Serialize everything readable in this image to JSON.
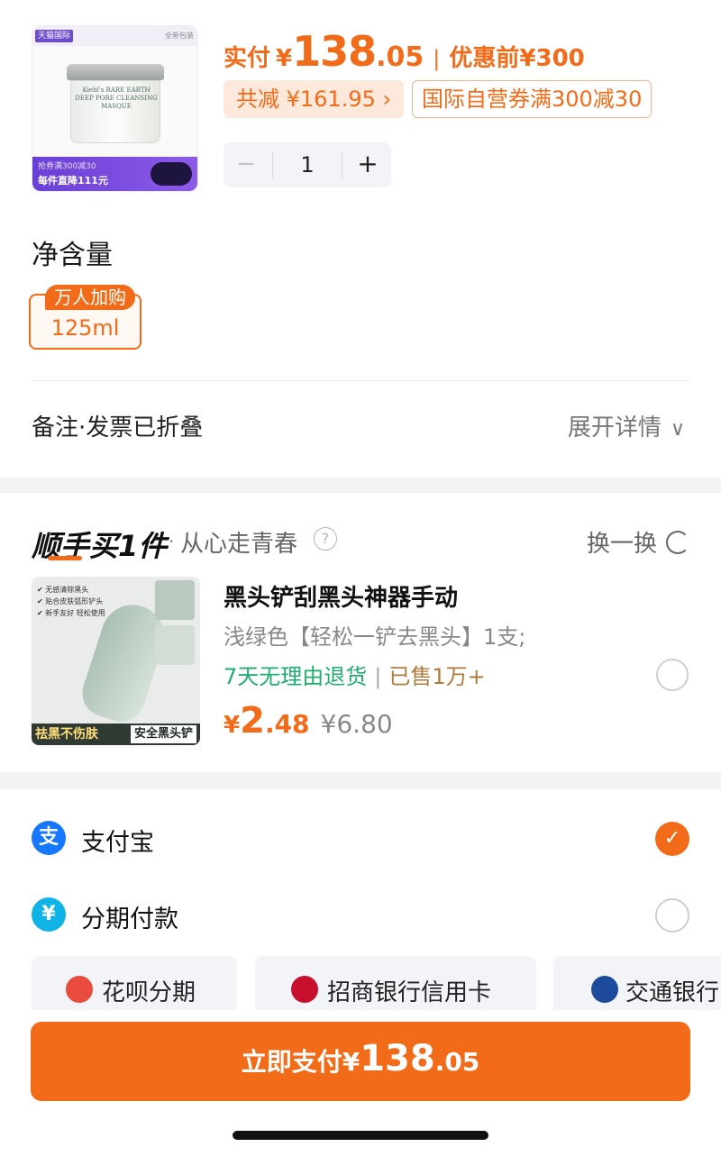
{
  "product": {
    "image_brand_tag": "天猫国际",
    "image_corner_text": "全新包装",
    "jar_label": "Kiehl's RARE EARTH DEEP PORE CLEANSING MASQUE",
    "image_promo_line1": "抢券满300减30",
    "image_promo_line2": "每件直降111元",
    "pay_label": "实付",
    "currency": "¥",
    "pay_integer": "138",
    "pay_decimal": ".05",
    "separator": "|",
    "before_discount_label": "优惠前",
    "before_discount_price": "¥300",
    "total_discount": "共减 ¥161.95 ›",
    "coupon": "国际自营券满300减30",
    "quantity": {
      "minus": "−",
      "value": "1",
      "plus": "+"
    }
  },
  "spec": {
    "title": "净含量",
    "option_tag": "万人加购",
    "option_value": "125ml"
  },
  "notes": {
    "label": "备注·发票已折叠",
    "expand": "展开详情",
    "chevron": "∨"
  },
  "recommend": {
    "title": "顺手买1件",
    "dot": "·",
    "subtitle": "从心走青春",
    "help": "?",
    "swap": "换一换",
    "image_features": "✔ 无感清除黑头\n✔ 贴合皮肤弧形铲头\n✔ 新手友好 轻松使用",
    "image_bar_left": "祛黑不伤肤",
    "image_bar_right": "安全黑头铲",
    "item_title": "黑头铲刮黑头神器手动",
    "item_spec": "浅绿色【轻松一铲去黑头】1支;",
    "return_policy": "7天无理由退货",
    "tag_sep": "|",
    "sold": "已售1万+",
    "currency": "¥",
    "price_integer": "2",
    "price_decimal": ".48",
    "original_price": "¥6.80"
  },
  "payment": {
    "methods": [
      {
        "icon": "alipay-icon",
        "glyph": "支",
        "label": "支付宝",
        "selected": true
      },
      {
        "icon": "installment-icon",
        "glyph": "¥",
        "label": "分期付款",
        "selected": false
      }
    ],
    "checkmark": "✓",
    "installments": [
      {
        "icon": "huabei-icon",
        "label": "花呗分期"
      },
      {
        "icon": "cmb-icon",
        "label": "招商银行信用卡"
      },
      {
        "icon": "bocom-icon",
        "label": "交通银行"
      }
    ],
    "pay_button": {
      "label": "立即支付",
      "currency": "¥",
      "integer": "138",
      "decimal": ".05"
    }
  },
  "colors": {
    "accent": "#f26b18",
    "alipay": "#1677ff",
    "green": "#1fae6e"
  }
}
